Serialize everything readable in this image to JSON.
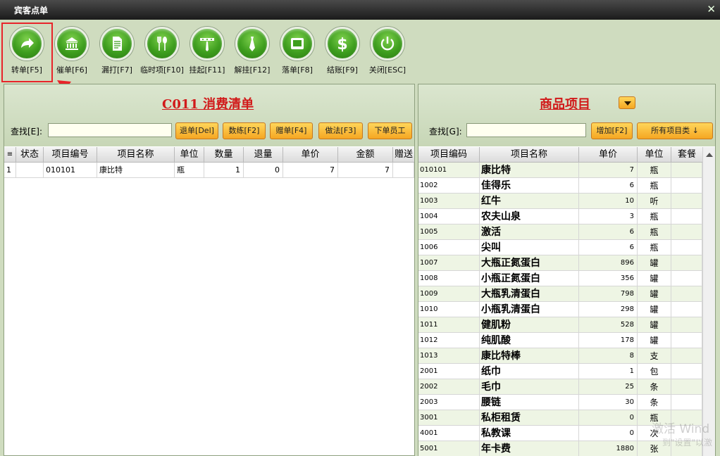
{
  "window": {
    "title": "宾客点单",
    "close_glyph": "✕"
  },
  "toolbar": [
    {
      "label": "转单[F5]",
      "icon": "redo-arrow-icon"
    },
    {
      "label": "催单[F6]",
      "icon": "bank-icon"
    },
    {
      "label": "漏打[F7]",
      "icon": "document-icon"
    },
    {
      "label": "临时项[F10]",
      "icon": "fork-spoon-icon"
    },
    {
      "label": "挂起[F11]",
      "icon": "waiter-icon"
    },
    {
      "label": "解挂[F12]",
      "icon": "tie-icon"
    },
    {
      "label": "落单[F8]",
      "icon": "ticket-icon"
    },
    {
      "label": "结账[F9]",
      "icon": "dollar-icon"
    },
    {
      "label": "关闭[ESC]",
      "icon": "power-icon"
    }
  ],
  "left_panel": {
    "title": "C011 消费清单",
    "search_label": "查找[E]:",
    "search_value": "",
    "buttons": [
      "退单[Del]",
      "数练[F2]",
      "赠单[F4]",
      "做法[F3]",
      "下单员工"
    ],
    "columns": [
      "≡",
      "状态",
      "项目编号",
      "项目名称",
      "单位",
      "数量",
      "退量",
      "单价",
      "金额",
      "赠送"
    ],
    "rows": [
      {
        "idx": "1",
        "status": "",
        "code": "010101",
        "name": "康比特",
        "unit": "瓶",
        "qty": "1",
        "ret": "0",
        "price": "7",
        "amount": "7",
        "gift": ""
      }
    ]
  },
  "right_panel": {
    "title": "商品项目",
    "search_label": "查找[G]:",
    "search_value": "",
    "add_button": "增加[F2]",
    "category_button": "所有项目类 ↓",
    "columns": [
      "项目编码",
      "项目名称",
      "单价",
      "单位",
      "套餐"
    ],
    "rows": [
      {
        "code": "010101",
        "name": "康比特",
        "price": "7",
        "unit": "瓶"
      },
      {
        "code": "1002",
        "name": "佳得乐",
        "price": "6",
        "unit": "瓶"
      },
      {
        "code": "1003",
        "name": "红牛",
        "price": "10",
        "unit": "听"
      },
      {
        "code": "1004",
        "name": "农夫山泉",
        "price": "3",
        "unit": "瓶"
      },
      {
        "code": "1005",
        "name": "激活",
        "price": "6",
        "unit": "瓶"
      },
      {
        "code": "1006",
        "name": "尖叫",
        "price": "6",
        "unit": "瓶"
      },
      {
        "code": "1007",
        "name": "大瓶正氮蛋白",
        "price": "896",
        "unit": "罐"
      },
      {
        "code": "1008",
        "name": "小瓶正氮蛋白",
        "price": "356",
        "unit": "罐"
      },
      {
        "code": "1009",
        "name": "大瓶乳清蛋白",
        "price": "798",
        "unit": "罐"
      },
      {
        "code": "1010",
        "name": "小瓶乳清蛋白",
        "price": "298",
        "unit": "罐"
      },
      {
        "code": "1011",
        "name": "健肌粉",
        "price": "528",
        "unit": "罐"
      },
      {
        "code": "1012",
        "name": "纯肌酸",
        "price": "178",
        "unit": "罐"
      },
      {
        "code": "1013",
        "name": "康比特棒",
        "price": "8",
        "unit": "支"
      },
      {
        "code": "2001",
        "name": "纸巾",
        "price": "1",
        "unit": "包"
      },
      {
        "code": "2002",
        "name": "毛巾",
        "price": "25",
        "unit": "条"
      },
      {
        "code": "2003",
        "name": "腰链",
        "price": "30",
        "unit": "条"
      },
      {
        "code": "3001",
        "name": "私柜租赁",
        "price": "0",
        "unit": "瓶"
      },
      {
        "code": "4001",
        "name": "私教课",
        "price": "0",
        "unit": "次"
      },
      {
        "code": "5001",
        "name": "年卡费",
        "price": "1880",
        "unit": "张"
      }
    ]
  },
  "watermark": {
    "line1": "激活 Wind",
    "line2": "到\"设置\"以激"
  },
  "colors": {
    "accent_red": "#d11a1a",
    "button_orange": "#f5a622",
    "icon_green": "#3e9e1e",
    "highlight": "#e8242a"
  }
}
